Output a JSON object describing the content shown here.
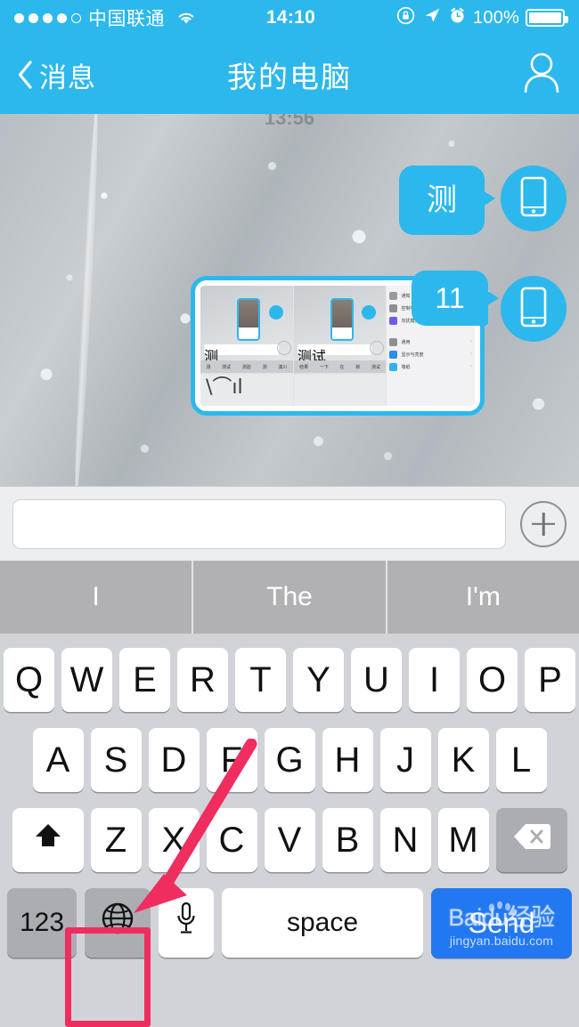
{
  "status_bar": {
    "signal_dots_filled": 4,
    "signal_dots_total": 5,
    "carrier": "中国联通",
    "wifi_icon": "wifi-icon",
    "time": "14:10",
    "rotation_lock_icon": "rotation-lock-icon",
    "location_icon": "location-arrow-icon",
    "alarm_icon": "alarm-clock-icon",
    "battery_percent": "100%",
    "battery_icon": "battery-full-icon"
  },
  "navbar": {
    "back_icon": "chevron-left-icon",
    "back_label": "消息",
    "title": "我的电脑",
    "right_icon": "person-profile-icon"
  },
  "chat": {
    "timestamp": "13:56",
    "messages": [
      {
        "id": "msg-text",
        "kind": "text",
        "text": "测",
        "avatar_icon": "device-phone-icon",
        "side": "right"
      },
      {
        "id": "msg-image",
        "kind": "image",
        "badge": "11",
        "avatar_icon": "device-phone-icon",
        "side": "right",
        "thumbnail": {
          "description": "screenshot-thumbnail",
          "pane_words_left": [
            "测",
            "测试",
            "测验",
            "测",
            "滇川"
          ],
          "pane_words_right": [
            "结果",
            "一下",
            "在",
            "新",
            "测试"
          ],
          "pane_input_left": "测",
          "pane_input_right": "测试",
          "scribble": "\\⌒ıl",
          "settings_rows": [
            {
              "label": "通知",
              "color": "#9a9a9e"
            },
            {
              "label": "控制中心",
              "color": "#8e8e93"
            },
            {
              "label": "勿扰模式",
              "color": "#6e5ce7"
            },
            {
              "label": "",
              "color": ""
            },
            {
              "label": "通用",
              "color": "#8e8e93"
            },
            {
              "label": "显示与亮度",
              "color": "#2d8cf0"
            },
            {
              "label": "墙纸",
              "color": "#30b0f0"
            }
          ]
        }
      }
    ]
  },
  "input_bar": {
    "field_value": "",
    "field_placeholder": "",
    "plus_icon": "plus-circle-icon"
  },
  "suggestions": [
    "I",
    "The",
    "I'm"
  ],
  "keyboard": {
    "row1": [
      "Q",
      "W",
      "E",
      "R",
      "T",
      "Y",
      "U",
      "I",
      "O",
      "P"
    ],
    "row2": [
      "A",
      "S",
      "D",
      "F",
      "G",
      "H",
      "J",
      "K",
      "L"
    ],
    "row3_letters": [
      "Z",
      "X",
      "C",
      "V",
      "B",
      "N",
      "M"
    ],
    "shift_icon": "shift-arrow-icon",
    "backspace_icon": "backspace-delete-icon",
    "numbers_label": "123",
    "globe_icon": "globe-language-icon",
    "mic_icon": "microphone-icon",
    "space_label": "space",
    "send_label": "Send"
  },
  "watermark": {
    "main": "Baidu经验",
    "sub": "jingyan.baidu.com",
    "paw_icon": "baidu-paw-icon"
  },
  "annotation": {
    "highlight_target": "globe-language-key",
    "box_color": "#ef2d5e",
    "arrow_color": "#ef2d5e"
  },
  "colors": {
    "brand_blue": "#2cb8ed",
    "send_blue": "#2278f0",
    "keyboard_bg": "#d1d3d9",
    "suggestion_bg": "#b1b1b3",
    "annotation_pink": "#ef2d5e"
  }
}
